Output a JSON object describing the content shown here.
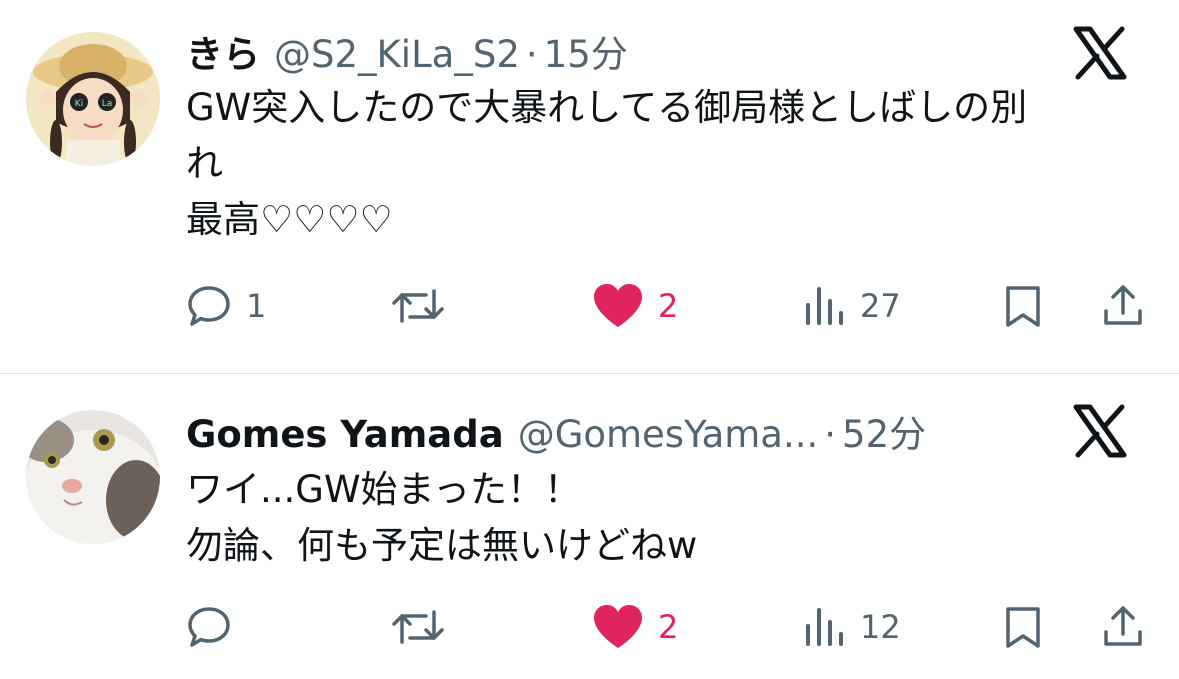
{
  "tweets": [
    {
      "name": "きら",
      "handle": "@S2_KiLa_S2",
      "separator": "·",
      "time": "15分",
      "text_lines": [
        "GW突入したので大暴れしてる御局様としばしの別",
        "れ",
        "最高♡♡♡♡"
      ],
      "avatar_text_left": "Ki",
      "avatar_text_right": "La",
      "replies": "1",
      "retweets": "",
      "likes": "2",
      "views": "27",
      "liked": true
    },
    {
      "name": "Gomes Yamada",
      "handle": "@GomesYama...",
      "separator": "·",
      "time": "52分",
      "text_lines": [
        "ワイ...GW始まった！！",
        "勿論、何も予定は無いけどねw"
      ],
      "replies": "",
      "retweets": "",
      "likes": "2",
      "views": "12",
      "liked": true
    }
  ],
  "icons": {
    "reply": "reply-icon",
    "retweet": "retweet-icon",
    "like": "heart-icon",
    "views": "views-icon",
    "bookmark": "bookmark-icon",
    "share": "share-icon",
    "brand": "x-logo-icon"
  },
  "colors": {
    "text": "#0f1419",
    "secondary": "#536471",
    "like": "#e0245e",
    "divider": "#dcdfe3"
  }
}
